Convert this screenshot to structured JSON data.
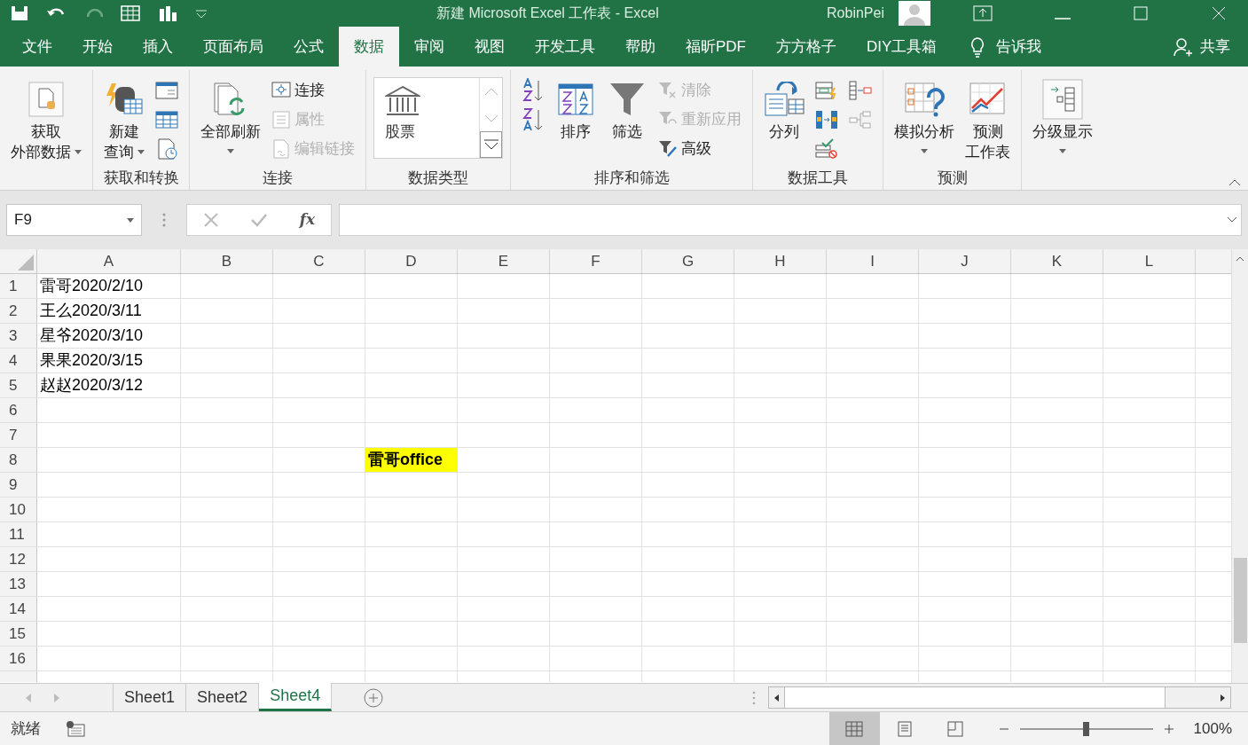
{
  "title_bar": {
    "title": "新建 Microsoft Excel 工作表  -  Excel",
    "user": "RobinPei"
  },
  "ribbon_tabs": [
    {
      "label": "文件",
      "selected": false
    },
    {
      "label": "开始",
      "selected": false
    },
    {
      "label": "插入",
      "selected": false
    },
    {
      "label": "页面布局",
      "selected": false
    },
    {
      "label": "公式",
      "selected": false
    },
    {
      "label": "数据",
      "selected": true
    },
    {
      "label": "审阅",
      "selected": false
    },
    {
      "label": "视图",
      "selected": false
    },
    {
      "label": "开发工具",
      "selected": false
    },
    {
      "label": "帮助",
      "selected": false
    },
    {
      "label": "福昕PDF",
      "selected": false
    },
    {
      "label": "方方格子",
      "selected": false
    },
    {
      "label": "DIY工具箱",
      "selected": false
    }
  ],
  "tell_me": "告诉我",
  "share": "共享",
  "ribbon_groups": [
    {
      "items": [
        {
          "kind": "large",
          "lines": [
            "获取",
            "外部数据"
          ],
          "dropdown": true,
          "disabled": false
        }
      ]
    },
    {
      "label": "获取和转换",
      "items": [
        {
          "kind": "large",
          "lines": [
            "新建",
            "查询"
          ],
          "dropdown": true,
          "disabled": false
        },
        {
          "kind": "icon",
          "disabled": false
        },
        {
          "kind": "icon",
          "disabled": false
        },
        {
          "kind": "icon",
          "disabled": false
        }
      ]
    },
    {
      "label": "连接",
      "items": [
        {
          "kind": "large",
          "lines": [
            "全部刷新"
          ],
          "dropdown": true,
          "disabled": false
        },
        {
          "kind": "small",
          "label": "连接",
          "disabled": false
        },
        {
          "kind": "small",
          "label": "属性",
          "disabled": true
        },
        {
          "kind": "small",
          "label": "编辑链接",
          "disabled": true
        }
      ]
    },
    {
      "label": "数据类型",
      "items": [
        {
          "kind": "gallery",
          "label": "股票",
          "disabled": false
        }
      ]
    },
    {
      "label": "排序和筛选",
      "items": [
        {
          "kind": "icon",
          "disabled": false
        },
        {
          "kind": "icon",
          "disabled": false
        },
        {
          "kind": "large",
          "lines": [
            "排序"
          ],
          "disabled": false
        },
        {
          "kind": "large",
          "lines": [
            "筛选"
          ],
          "disabled": false
        },
        {
          "kind": "small",
          "label": "清除",
          "disabled": true
        },
        {
          "kind": "small",
          "label": "重新应用",
          "disabled": true
        },
        {
          "kind": "small",
          "label": "高级",
          "disabled": false
        }
      ]
    },
    {
      "label": "数据工具",
      "items": [
        {
          "kind": "large",
          "lines": [
            "分列"
          ],
          "disabled": false
        },
        {
          "kind": "icon",
          "disabled": false
        },
        {
          "kind": "icon",
          "disabled": false
        },
        {
          "kind": "icon",
          "disabled": false
        },
        {
          "kind": "icon",
          "disabled": false
        },
        {
          "kind": "icon",
          "disabled": false
        }
      ]
    },
    {
      "label": "预测",
      "items": [
        {
          "kind": "large",
          "lines": [
            "模拟分析"
          ],
          "dropdown": true,
          "disabled": false
        },
        {
          "kind": "large",
          "lines": [
            "预测",
            "工作表"
          ],
          "disabled": false
        }
      ]
    },
    {
      "items": [
        {
          "kind": "large",
          "lines": [
            "分级显示"
          ],
          "dropdown": true,
          "disabled": false
        }
      ]
    }
  ],
  "formula_bar": {
    "name_box": "F9",
    "function_label": "fx"
  },
  "columns": [
    "A",
    "B",
    "C",
    "D",
    "E",
    "F",
    "G",
    "H",
    "I",
    "J",
    "K",
    "L"
  ],
  "rows": [
    {
      "header": "1",
      "cells": [
        {
          "text": "雷哥2020/2/10",
          "bold": false
        }
      ]
    },
    {
      "header": "2",
      "cells": [
        {
          "text": "王么2020/3/11",
          "bold": false
        }
      ]
    },
    {
      "header": "3",
      "cells": [
        {
          "text": "星爷2020/3/10",
          "bold": false
        }
      ]
    },
    {
      "header": "4",
      "cells": [
        {
          "text": "果果2020/3/15",
          "bold": false
        }
      ]
    },
    {
      "header": "5",
      "cells": [
        {
          "text": "赵赵2020/3/12",
          "bold": false
        }
      ]
    },
    {
      "header": "6",
      "cells": []
    },
    {
      "header": "7",
      "cells": []
    },
    {
      "header": "8",
      "cells": [
        null,
        null,
        null,
        {
          "text": "雷哥office",
          "bold": true,
          "highlighted": true
        }
      ]
    },
    {
      "header": "9",
      "cells": []
    },
    {
      "header": "10",
      "cells": []
    },
    {
      "header": "11",
      "cells": []
    },
    {
      "header": "12",
      "cells": []
    },
    {
      "header": "13",
      "cells": []
    },
    {
      "header": "14",
      "cells": []
    },
    {
      "header": "15",
      "cells": []
    },
    {
      "header": "16",
      "cells": []
    }
  ],
  "sheet_tabs": [
    {
      "label": "Sheet1",
      "selected": false
    },
    {
      "label": "Sheet2",
      "selected": false
    },
    {
      "label": "Sheet4",
      "selected": true
    }
  ],
  "status_bar": {
    "status": "就绪",
    "views": [
      {
        "selected": true
      },
      {
        "selected": false
      },
      {
        "selected": false
      }
    ],
    "zoom": {
      "level": 0.5,
      "reading": "100%"
    }
  }
}
